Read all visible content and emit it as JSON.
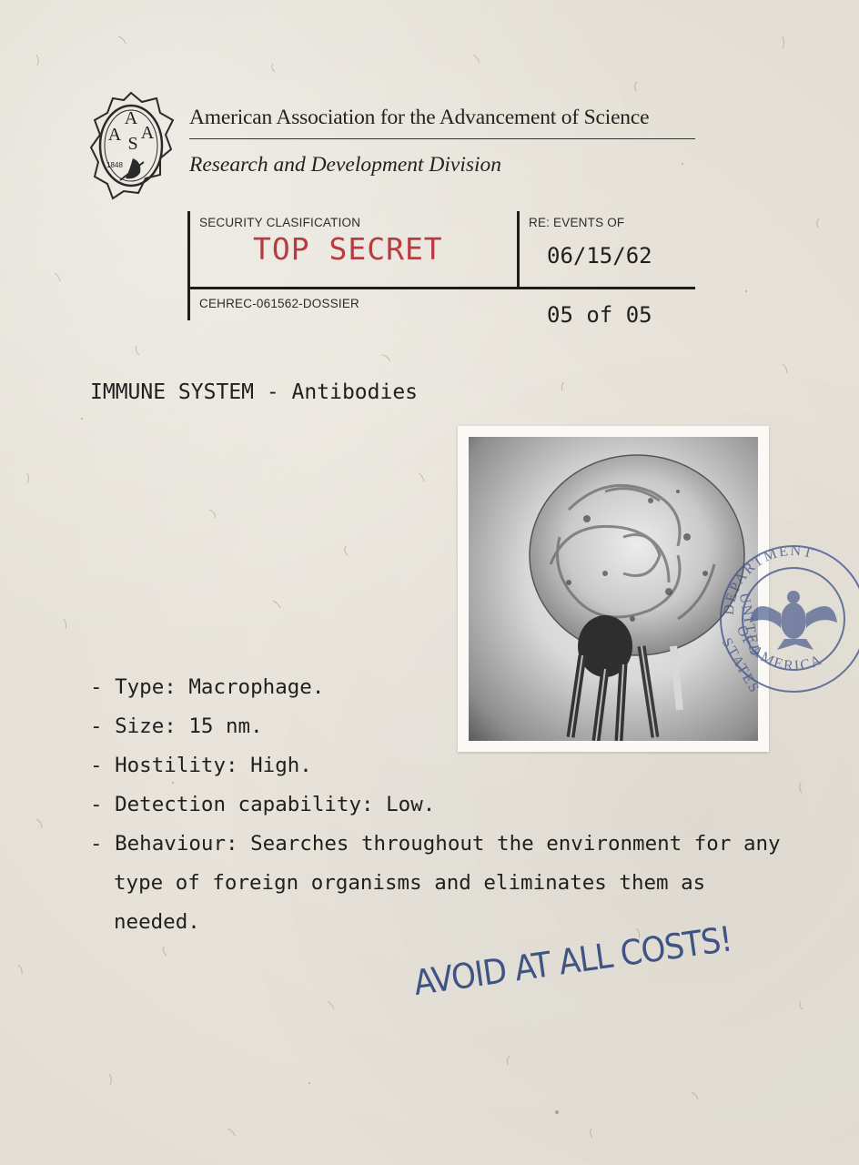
{
  "header": {
    "organization": "American Association for the Advancement of Science",
    "division": "Research and Development Division",
    "seal": {
      "initials": [
        "A",
        "A",
        "S",
        "A"
      ],
      "year": "1848"
    }
  },
  "classification_box": {
    "security_label": "SECURITY CLASIFICATION",
    "security_value": "TOP SECRET",
    "re_label": "RE: EVENTS OF",
    "re_date": "06/15/62",
    "dossier_code": "CEHREC-061562-DOSSIER",
    "page_indicator": "05 of 05",
    "security_color": "#b02a2f"
  },
  "section": {
    "heading": "IMMUNE SYSTEM - Antibodies"
  },
  "facts": [
    "- Type: Macrophage.",
    "- Size: 15 nm.",
    "- Hostility: High.",
    "- Detection capability: Low.",
    "- Behaviour: Searches throughout the environment for any type of foreign organisms and eliminates them as needed."
  ],
  "stamp": {
    "text_top": "DEPARTMENT",
    "text_left": "UNITED",
    "text_left2": "STATES",
    "text_bottom": "OF AMERICA",
    "color": "#3d4f86"
  },
  "annotation": {
    "handwritten": "AVOID AT ALL COSTS!",
    "color": "#3d5485"
  }
}
